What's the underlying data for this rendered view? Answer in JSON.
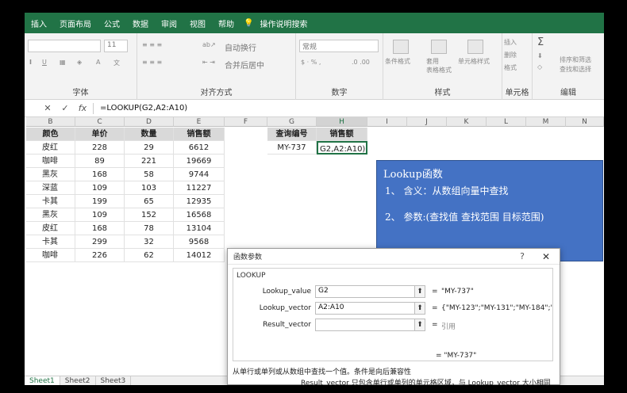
{
  "ribbon_tabs": [
    "插入",
    "页面布局",
    "公式",
    "数据",
    "审阅",
    "视图",
    "帮助"
  ],
  "tell_me": "操作说明搜索",
  "ribbon": {
    "font_size": "11",
    "font_group": "字体",
    "wrap_text": "自动换行",
    "merge_center": "合并后居中",
    "alignment_group": "对齐方式",
    "number_format": "常规",
    "number_group": "数字",
    "conditional_format": "条件格式",
    "format_as_table": "套用\n表格格式",
    "cell_styles": "单元格样式",
    "styles_group": "样式",
    "insert": "插入",
    "delete": "删除",
    "format": "格式",
    "cells_group": "单元格",
    "sort_filter": "排序和筛选",
    "find_select": "查找和选择",
    "editing_group": "编辑"
  },
  "formula_bar": {
    "cancel": "✕",
    "enter": "✓",
    "fx": "fx",
    "formula": "=LOOKUP(G2,A2:A10)"
  },
  "columns": [
    "B",
    "C",
    "D",
    "E",
    "F",
    "G",
    "H",
    "I",
    "J",
    "K",
    "L",
    "M",
    "N"
  ],
  "table": {
    "headers": [
      "颜色",
      "单价",
      "数量",
      "销售额"
    ],
    "rows": [
      [
        "皮红",
        "228",
        "29",
        "6612"
      ],
      [
        "咖啡",
        "89",
        "221",
        "19669"
      ],
      [
        "黑灰",
        "168",
        "58",
        "9744"
      ],
      [
        "深蓝",
        "109",
        "103",
        "11227"
      ],
      [
        "卡其",
        "199",
        "65",
        "12935"
      ],
      [
        "黑灰",
        "109",
        "152",
        "16568"
      ],
      [
        "皮红",
        "168",
        "78",
        "13104"
      ],
      [
        "卡其",
        "299",
        "32",
        "9568"
      ],
      [
        "咖啡",
        "226",
        "62",
        "14012"
      ]
    ]
  },
  "lookup_table": {
    "headers": [
      "查询编号",
      "销售额"
    ],
    "value": "MY-737",
    "editing": "G2,A2:A10)"
  },
  "note": {
    "title": "Lookup函数",
    "line1": "1、 含义：从数组向量中查找",
    "line2": "2、 参数:(查找值 查找范围 目标范围)"
  },
  "dialog": {
    "title": "函数参数",
    "help": "?",
    "close": "✕",
    "function_name": "LOOKUP",
    "args": [
      {
        "label": "Lookup_value",
        "input": "G2",
        "value": "\"MY-737\""
      },
      {
        "label": "Lookup_vector",
        "input": "A2:A10",
        "value": "{\"MY-123\";\"MY-131\";\"MY-184\";\"MY"
      },
      {
        "label": "Result_vector",
        "input": "",
        "value": "引用"
      }
    ],
    "result": "= \"MY-737\"",
    "description": "从单行或单列或从数组中查找一个值。条件是向后兼容性",
    "arg_description": "Result_vector   只包含单行或单列的单元格区域，与 Lookup_vector 大小相同"
  },
  "sheets": [
    "Sheet1",
    "Sheet2",
    "Sheet3"
  ],
  "colors": {
    "excel_green": "#217346",
    "note_blue": "#4472c4",
    "header_gray": "#d9d9d9"
  }
}
